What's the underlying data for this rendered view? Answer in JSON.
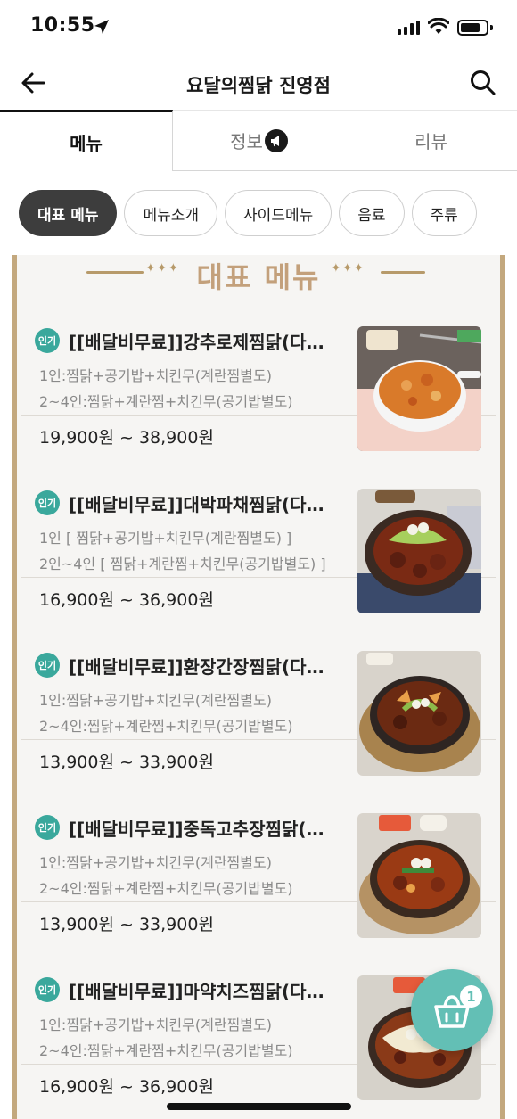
{
  "status_bar": {
    "time": "10:55"
  },
  "header": {
    "title": "요달의찜닭 진영점"
  },
  "tabs": [
    {
      "label": "메뉴",
      "active": true
    },
    {
      "label": "정보",
      "active": false
    },
    {
      "label": "리뷰",
      "active": false
    }
  ],
  "chips": [
    {
      "label": "대표 메뉴",
      "active": true
    },
    {
      "label": "메뉴소개",
      "active": false
    },
    {
      "label": "사이드메뉴",
      "active": false
    },
    {
      "label": "음료",
      "active": false
    },
    {
      "label": "주류",
      "active": false
    }
  ],
  "section": {
    "title": "대표 메뉴",
    "left_ornament": "✦✦✦",
    "right_ornament": "✦✦✦"
  },
  "items": [
    {
      "badge": "인기",
      "name": "[[배달비무료]]강추로제찜닭(다…",
      "desc1": "1인:찜닭+공기밥+치킨무(계란찜별도)",
      "desc2": "2~4인:찜닭+계란찜+치킨무(공기밥별도)",
      "price": "19,900원 ~ 38,900원"
    },
    {
      "badge": "인기",
      "name": "[[배달비무료]]대박파채찜닭(다…",
      "desc1": "1인 [ 찜닭+공기밥+치킨무(계란찜별도) ]",
      "desc2": "2인~4인 [ 찜닭+계란찜+치킨무(공기밥별도) ]",
      "price": "16,900원 ~ 36,900원"
    },
    {
      "badge": "인기",
      "name": "[[배달비무료]]환장간장찜닭(다…",
      "desc1": "1인:찜닭+공기밥+치킨무(계란찜별도)",
      "desc2": "2~4인:찜닭+계란찜+치킨무(공기밥별도)",
      "price": "13,900원 ~ 33,900원"
    },
    {
      "badge": "인기",
      "name": "[[배달비무료]]중독고추장찜닭(…",
      "desc1": "1인:찜닭+공기밥+치킨무(계란찜별도)",
      "desc2": "2~4인:찜닭+계란찜+치킨무(공기밥별도)",
      "price": "13,900원 ~ 33,900원"
    },
    {
      "badge": "인기",
      "name": "[[배달비무료]]마약치즈찜닭(다…",
      "desc1": "1인:찜닭+공기밥+치킨무(계란찜별도)",
      "desc2": "2~4인:찜닭+계란찜+치킨무(공기밥별도)",
      "price": "16,900원 ~ 36,900원"
    }
  ],
  "cart": {
    "count": "1"
  },
  "colors": {
    "accent": "#63bfb5",
    "badge": "#3aa89c",
    "gold": "#c3a07b",
    "chip_active": "#3d3d3d"
  },
  "icons": {
    "back": "arrow-left-icon",
    "search": "search-icon",
    "info": "megaphone-icon",
    "cart": "basket-icon",
    "location": "location-arrow-icon"
  }
}
